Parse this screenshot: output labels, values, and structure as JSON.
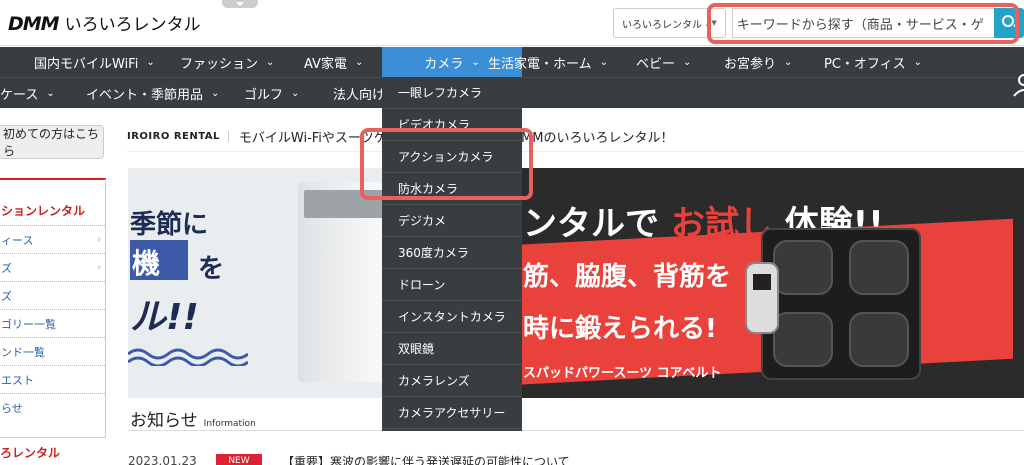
{
  "header": {
    "logo_brand": "DMM",
    "logo_text": "いろいろレンタル",
    "search": {
      "category": "いろいろレンタル",
      "placeholder": "キーワードから探す（商品・サービス・ゲ"
    }
  },
  "nav": {
    "row1": [
      {
        "label": "国内モバイルWiFi"
      },
      {
        "label": "ファッション"
      },
      {
        "label": "AV家電"
      },
      {
        "label": "カメラ"
      },
      {
        "label": "生活家電・ホーム"
      },
      {
        "label": "ベビー"
      },
      {
        "label": "お宮参り"
      },
      {
        "label": "PC・オフィス"
      }
    ],
    "row2": [
      {
        "label": "ケース"
      },
      {
        "label": "イベント・季節用品"
      },
      {
        "label": "ゴルフ"
      },
      {
        "label": "法人向け"
      }
    ]
  },
  "dropdown": {
    "items": [
      "一眼レフカメラ",
      "ビデオカメラ",
      "アクションカメラ",
      "防水カメラ",
      "デジカメ",
      "360度カメラ",
      "ドローン",
      "インスタントカメラ",
      "双眼鏡",
      "カメラレンズ",
      "カメラアクセサリー"
    ]
  },
  "sidebar": {
    "first_time_button": "初めての方はこちら",
    "heading": "ションレンタル",
    "items": [
      {
        "label": "ィース"
      },
      {
        "label": "ズ"
      },
      {
        "label": "ズ"
      },
      {
        "label": "ゴリー一覧"
      },
      {
        "label": "ンド一覧"
      },
      {
        "label": "エスト"
      },
      {
        "label": "らせ"
      }
    ],
    "footer_heading": "ろレンタル"
  },
  "info_strip": {
    "label": "IROIRO RENTAL",
    "text_left": "モバイルWi-Fiやスーツケ",
    "text_right": "DMMのいろいろレンタル！"
  },
  "banner": {
    "left_line1": "季節に",
    "left_box": "機",
    "left_line2b": "を",
    "left_line3": "ル!!",
    "right_line1_a": "ンタルで",
    "right_line1_b": "お試し",
    "right_line1_c": "体験!!",
    "right_line2": "筋、脇腹、背筋を",
    "right_line3": "時に鍛えられる!",
    "right_line4": "スパッドパワースーツ コアベルト"
  },
  "news": {
    "title": "お知らせ",
    "subtitle": "Information",
    "rows": [
      {
        "date": "2023.01.23",
        "badge": "NEW",
        "text": "【重要】寒波の影響に伴う発送遅延の可能性について"
      }
    ]
  },
  "colors": {
    "nav_bg": "#3a3d40",
    "nav_active": "#3b8fd6",
    "search_btn": "#24a3c9",
    "highlight": "#e8615d",
    "brand_red": "#c22"
  }
}
